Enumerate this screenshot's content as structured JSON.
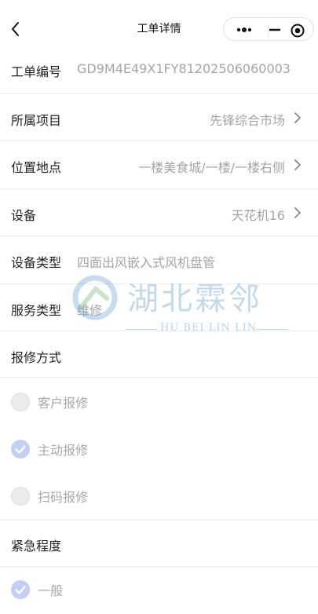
{
  "nav": {
    "title": "工单详情",
    "back_icon": "chevron-left-icon",
    "capsule": {
      "more_icon": "more-dots-icon",
      "minimize_icon": "minimize-icon",
      "close_icon": "target-circle-icon"
    }
  },
  "fields": [
    {
      "label": "工单编号",
      "value": "GD9M4E49X1FY81202506060003"
    },
    {
      "label": "所属项目",
      "value": "先锋综合市场"
    },
    {
      "label": "位置地点",
      "value": "一楼美食城/一楼/一楼右侧"
    },
    {
      "label": "设备",
      "value": "天花机16"
    },
    {
      "label": "设备类型",
      "value": "四面出风嵌入式风机盘管"
    },
    {
      "label": "服务类型",
      "value": "维修"
    }
  ],
  "repair_method": {
    "label": "报修方式",
    "options": [
      {
        "label": "客户报修",
        "checked": false
      },
      {
        "label": "主动报修",
        "checked": true
      },
      {
        "label": "扫码报修",
        "checked": false
      }
    ]
  },
  "urgency": {
    "label": "紧急程度",
    "options": [
      {
        "label": "一般",
        "checked": true
      }
    ]
  },
  "watermark": {
    "title": "湖北霖邻",
    "subtitle": "HU BEI LIN LIN"
  },
  "colors": {
    "accent_check": "#c4cff5",
    "value_text": "#a4a4a4",
    "divider": "#ececec"
  }
}
